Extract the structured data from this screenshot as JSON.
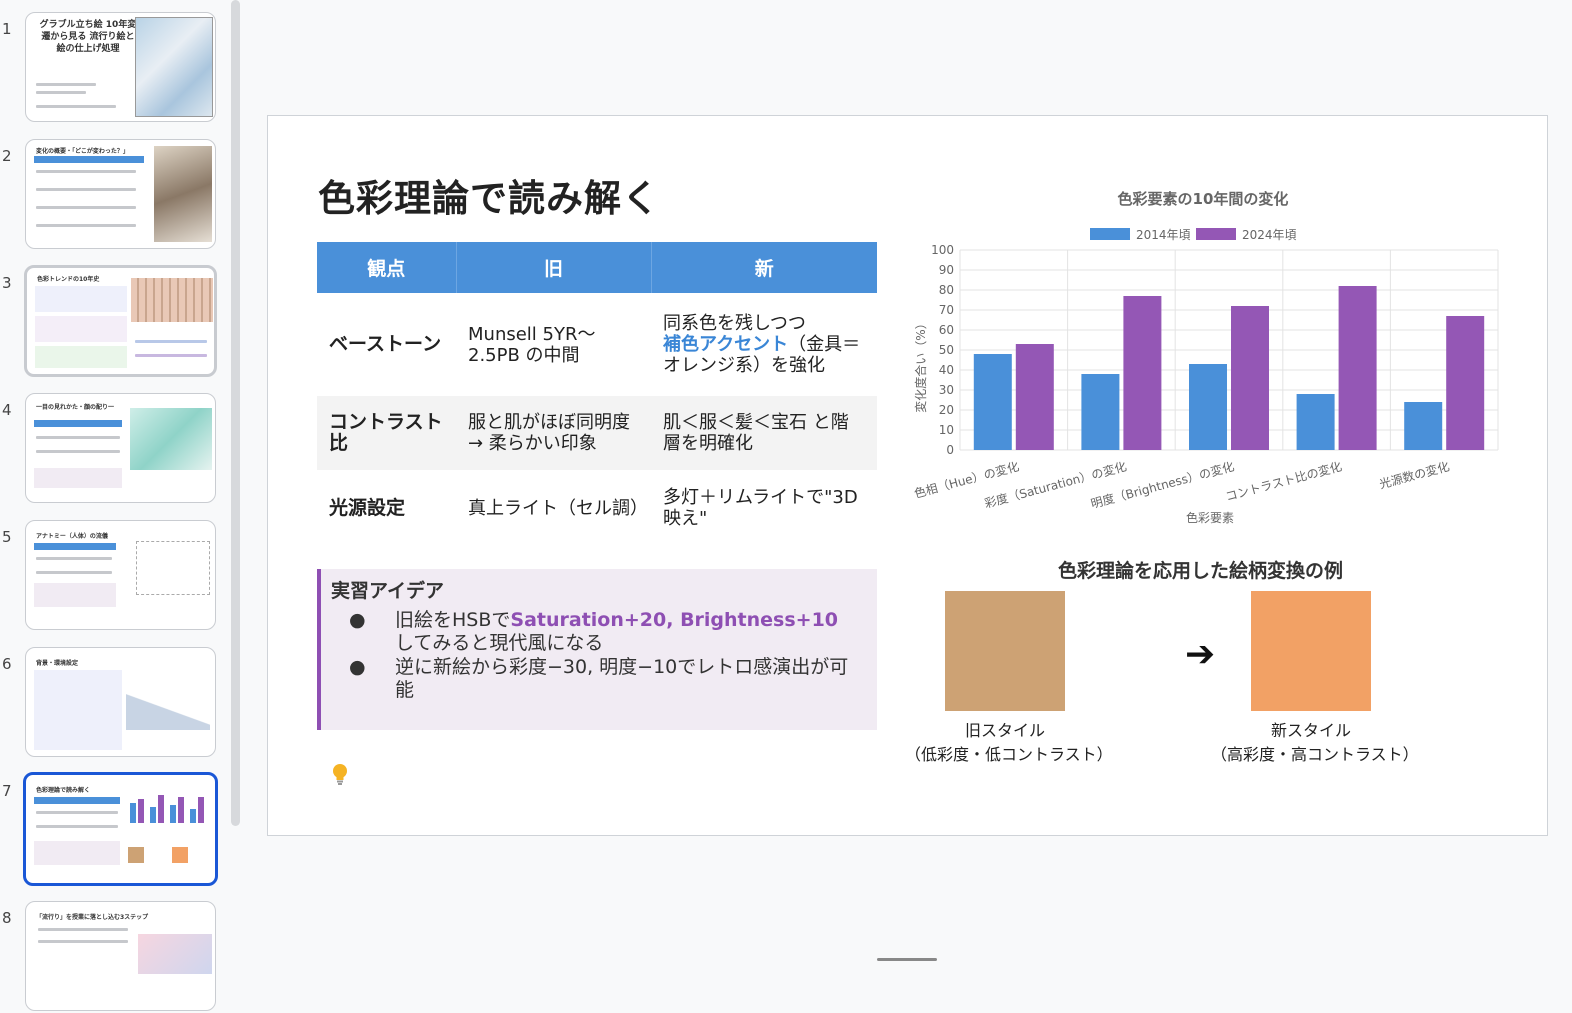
{
  "sidebar": {
    "slides": [
      {
        "num": "1",
        "title": "グラブル立ち絵 10年変遷から見る 流行り絵と 絵の仕上げ処理"
      },
      {
        "num": "2",
        "title": "変化の概要・「どこが変わった？」"
      },
      {
        "num": "3",
        "title": "色彩トレンドの10年史"
      },
      {
        "num": "4",
        "title": "一目の見れかた・顔の配り一"
      },
      {
        "num": "5",
        "title": "アナトミー（人体）の流儀"
      },
      {
        "num": "6",
        "title": "背景・環境設定"
      },
      {
        "num": "7",
        "title": "色彩理論で読み解く"
      },
      {
        "num": "8",
        "title": "「流行り」を授業に落とし込む3ステップ"
      }
    ]
  },
  "slide": {
    "title": "色彩理論で読み解く",
    "table": {
      "headers": [
        "観点",
        "旧",
        "新"
      ],
      "rows": [
        {
          "aspect": "ベーストーン",
          "old": "Munsell 5YR〜2.5PB の中間",
          "new_pre": "同系色を残しつつ",
          "new_accent": "補色アクセント",
          "new_post": "（金具＝オレンジ系）を強化"
        },
        {
          "aspect": "コントラスト比",
          "old": "服と肌がほぼ同明度 → 柔らかい印象",
          "new": "肌＜服＜髪＜宝石 と階層を明確化"
        },
        {
          "aspect": "光源設定",
          "old": "真上ライト（セル調）",
          "new": "多灯＋リムライトで\"3D映え\""
        }
      ]
    },
    "idea": {
      "title": "実習アイデア",
      "bullet": "●",
      "item1_pre": "旧絵をHSBで",
      "item1_highlight": "Saturation+20, Brightness+10",
      "item1_post": "してみると現代風になる",
      "item2": "逆に新絵から彩度−30, 明度−10でレトロ感演出が可能"
    },
    "example": {
      "title": "色彩理論を応用した絵柄変換の例",
      "old_color": "#cda274",
      "new_color": "#f2a165",
      "arrow": "➔",
      "old_label_1": "旧スタイル",
      "old_label_2": "（低彩度・低コントラスト）",
      "new_label_1": "新スタイル",
      "new_label_2": "（高彩度・高コントラスト）"
    }
  },
  "chart_data": {
    "type": "bar",
    "title": "色彩要素の10年間の変化",
    "xlabel": "色彩要素",
    "ylabel": "変化度合い（%）",
    "ylim": [
      0,
      100
    ],
    "yticks": [
      0,
      10,
      20,
      30,
      40,
      50,
      60,
      70,
      80,
      90,
      100
    ],
    "grid": true,
    "legend": "top",
    "categories": [
      "色相（Hue）の変化",
      "彩度（Saturation）の変化",
      "明度（Brightness）の変化",
      "コントラスト比の変化",
      "光源数の変化"
    ],
    "series": [
      {
        "name": "2014年頃",
        "color": "#4a90d9",
        "values": [
          48,
          38,
          43,
          28,
          24
        ]
      },
      {
        "name": "2024年頃",
        "color": "#9457b5",
        "values": [
          53,
          77,
          72,
          82,
          67
        ]
      }
    ]
  }
}
